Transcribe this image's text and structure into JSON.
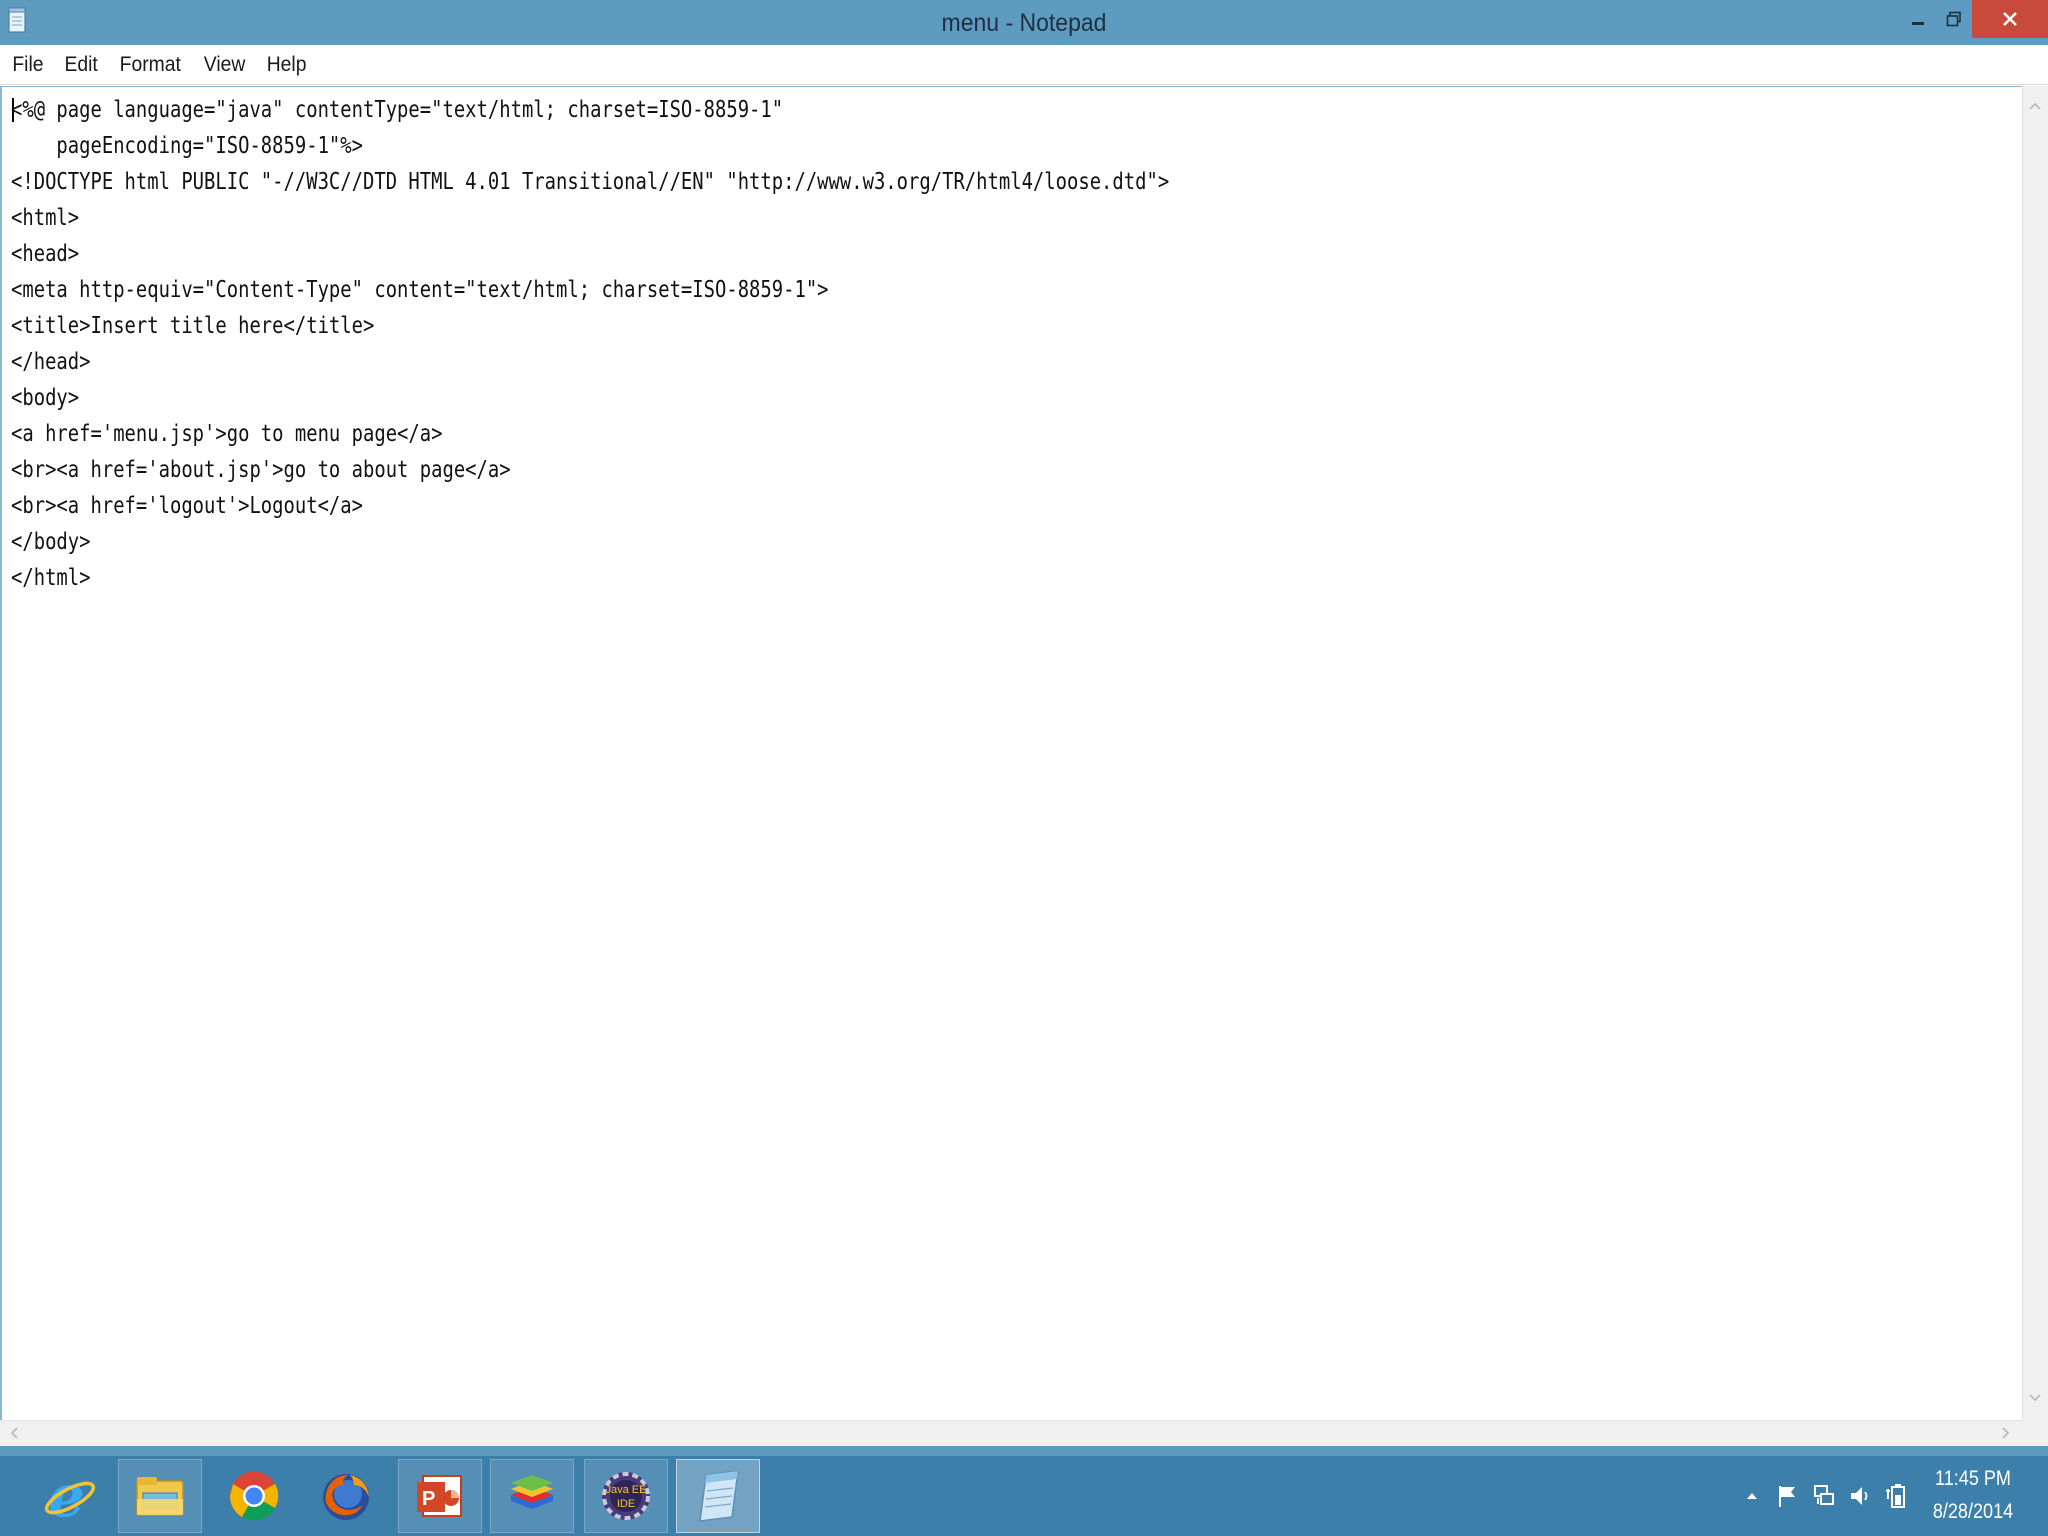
{
  "window": {
    "title": "menu - Notepad",
    "buttons": {
      "minimize_icon": "minimize-icon",
      "maximize_icon": "restore-icon",
      "close_icon": "close-icon"
    }
  },
  "menubar": {
    "items": [
      "File",
      "Edit",
      "Format",
      "View",
      "Help"
    ]
  },
  "editor": {
    "lines": [
      "<%@ page language=\"java\" contentType=\"text/html; charset=ISO-8859-1\"",
      "    pageEncoding=\"ISO-8859-1\"%>",
      "<!DOCTYPE html PUBLIC \"-//W3C//DTD HTML 4.01 Transitional//EN\" \"http://www.w3.org/TR/html4/loose.dtd\">",
      "<html>",
      "<head>",
      "<meta http-equiv=\"Content-Type\" content=\"text/html; charset=ISO-8859-1\">",
      "<title>Insert title here</title>",
      "</head>",
      "<body>",
      "<a href='menu.jsp'>go to menu page</a>",
      "<br><a href='about.jsp'>go to about page</a>",
      "<br><a href='logout'>Logout</a>",
      "</body>",
      "</html>"
    ]
  },
  "taskbar": {
    "apps": [
      {
        "name": "internet-explorer-icon"
      },
      {
        "name": "file-explorer-icon"
      },
      {
        "name": "chrome-icon"
      },
      {
        "name": "firefox-icon"
      },
      {
        "name": "powerpoint-icon"
      },
      {
        "name": "bluestacks-icon"
      },
      {
        "name": "java-ee-ide-icon",
        "label": "Java EE IDE"
      },
      {
        "name": "notepad-icon"
      }
    ],
    "tray": [
      "show-hidden-icons-arrow",
      "action-center-flag-icon",
      "network-icon",
      "volume-icon",
      "power-icon"
    ],
    "clock": {
      "time": "11:45 PM",
      "date": "8/28/2014"
    }
  },
  "colors": {
    "titlebar": "#5d9cc0",
    "taskbar": "#3d7fab",
    "close_button": "#c84a3c"
  }
}
